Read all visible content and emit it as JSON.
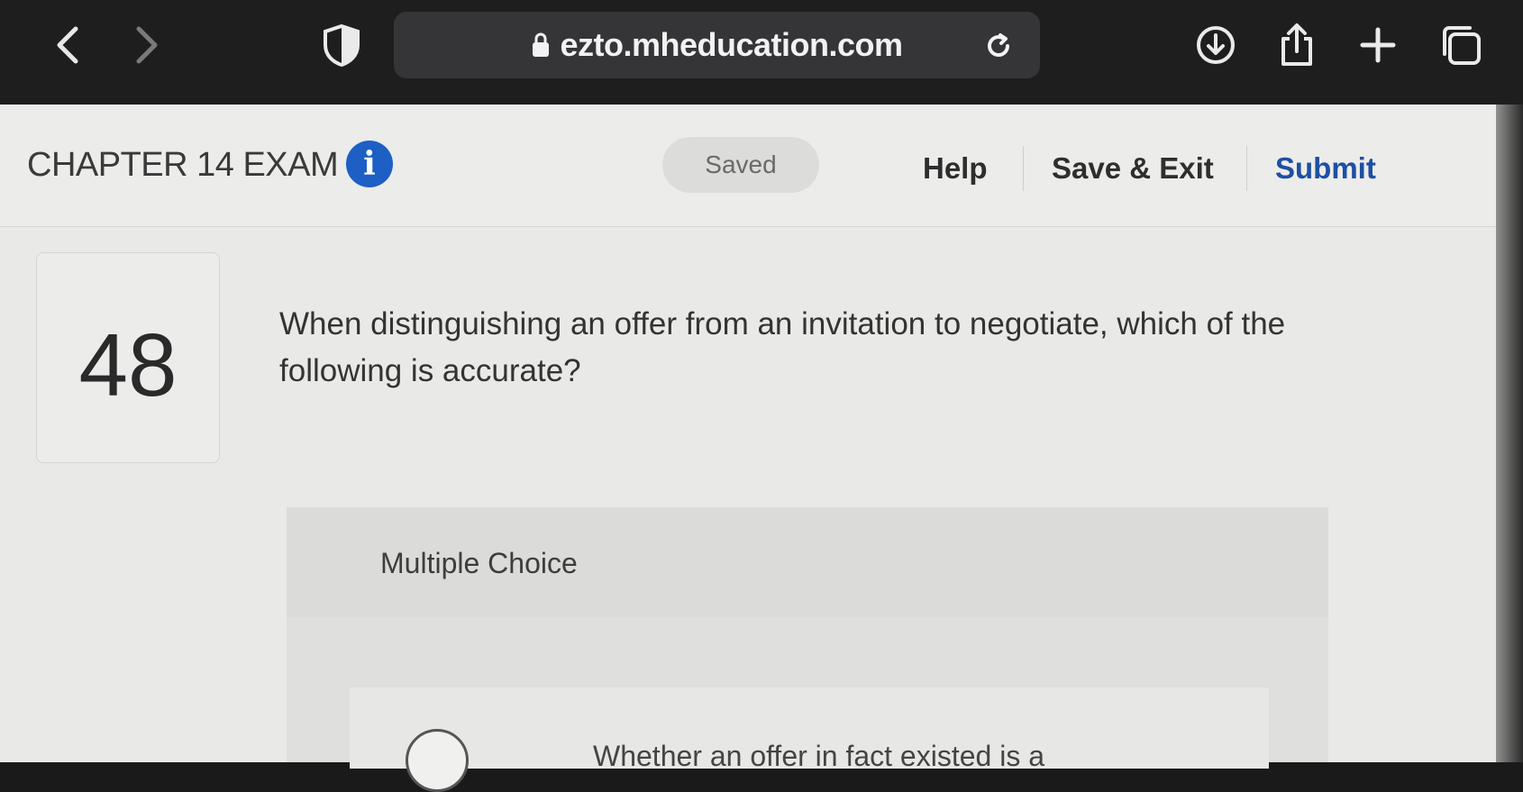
{
  "browser": {
    "url": "ezto.mheducation.com"
  },
  "header": {
    "exam_title": "CHAPTER 14 EXAM",
    "info_glyph": "i",
    "saved_status": "Saved",
    "help_label": "Help",
    "save_exit_label": "Save & Exit",
    "submit_label": "Submit"
  },
  "question": {
    "number": "48",
    "text": "When distinguishing an offer from an invitation to negotiate, which of the following is accurate?",
    "type_label": "Multiple Choice",
    "options": [
      {
        "text": "Whether an offer in fact existed is a"
      }
    ]
  },
  "colors": {
    "accent": "#1d4fa3",
    "info_icon": "#1d5fc4"
  },
  "icons": [
    "back-chevron-icon",
    "forward-chevron-icon",
    "shield-icon",
    "lock-icon",
    "reload-icon",
    "download-icon",
    "share-icon",
    "new-tab-plus-icon",
    "tabs-icon",
    "info-icon",
    "radio-button"
  ]
}
